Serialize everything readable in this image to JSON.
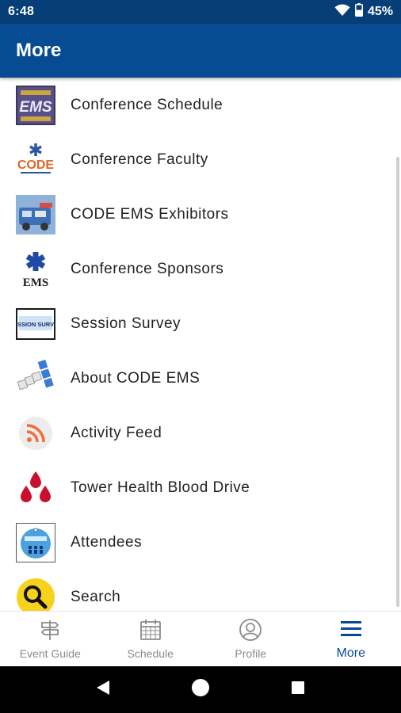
{
  "status_bar": {
    "time": "6:48",
    "battery": "45%"
  },
  "header": {
    "title": "More"
  },
  "colors": {
    "status_bar": "#063e78",
    "app_bar": "#074b93",
    "active": "#0a4a94",
    "inactive": "#8a8a8a"
  },
  "menu": {
    "items": [
      {
        "label": "Conference Schedule",
        "icon": "ems-logo-icon"
      },
      {
        "label": "Conference Faculty",
        "icon": "code-logo-icon"
      },
      {
        "label": "CODE EMS Exhibitors",
        "icon": "ambulance-icon"
      },
      {
        "label": "Conference Sponsors",
        "icon": "star-of-life-icon"
      },
      {
        "label": "Session Survey",
        "icon": "session-survey-icon"
      },
      {
        "label": "About CODE EMS",
        "icon": "about-blocks-icon"
      },
      {
        "label": "Activity Feed",
        "icon": "rss-icon"
      },
      {
        "label": "Tower Health Blood Drive",
        "icon": "blood-drops-icon"
      },
      {
        "label": "Attendees",
        "icon": "attendees-icon"
      },
      {
        "label": "Search",
        "icon": "search-icon"
      }
    ]
  },
  "bottom_nav": {
    "items": [
      {
        "label": "Event Guide",
        "icon": "signpost-icon",
        "active": false
      },
      {
        "label": "Schedule",
        "icon": "calendar-icon",
        "active": false
      },
      {
        "label": "Profile",
        "icon": "profile-icon",
        "active": false
      },
      {
        "label": "More",
        "icon": "menu-icon",
        "active": true
      }
    ]
  }
}
